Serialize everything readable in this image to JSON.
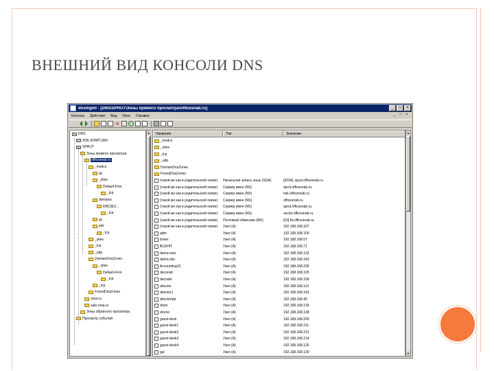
{
  "slide": {
    "title": "ВНЕШНИЙ ВИД КОНСОЛИ DNS",
    "accent_color": "#f57a3d",
    "frame_color": "#f4c9b8"
  },
  "window": {
    "title": "dnsmgmt - [DNS\\SPRUT\\Зоны прямого просмотра\\officesnab.ru]",
    "minimize": "_",
    "maximize": "□",
    "close": "×",
    "menu": [
      "Консоль",
      "Действие",
      "Вид",
      "Окно",
      "Справка"
    ],
    "mdi_buttons": [
      "_",
      "□",
      "×"
    ],
    "titlebar_color": "#0a246a"
  },
  "tree": {
    "items": [
      {
        "label": "DNS"
      },
      {
        "label": "ЛОК.КОМП.SRV"
      },
      {
        "label": "SPRUT"
      },
      {
        "label": "Зоны прямого просмотра"
      },
      {
        "label": "officesnab.ru"
      },
      {
        "label": "_msdcs"
      },
      {
        "label": "dc"
      },
      {
        "label": "_sites"
      },
      {
        "label": "Default-First"
      },
      {
        "label": "_tcp"
      },
      {
        "label": "domains"
      },
      {
        "label": "KBC3E2..."
      },
      {
        "label": "_tcp"
      },
      {
        "label": "gc"
      },
      {
        "label": "pdc"
      },
      {
        "label": "_tcp"
      },
      {
        "label": "_sites"
      },
      {
        "label": "_tcp"
      },
      {
        "label": "_udp"
      },
      {
        "label": "DomainDnsZones"
      },
      {
        "label": "_sites"
      },
      {
        "label": "Default-First"
      },
      {
        "label": "_tcp"
      },
      {
        "label": "_tcp"
      },
      {
        "label": "ForestDnsZones"
      },
      {
        "label": "runa.ru"
      },
      {
        "label": "sale.runa.ru"
      },
      {
        "label": "Зоны обратного просмотра"
      },
      {
        "label": "Просмотр событий"
      }
    ]
  },
  "list": {
    "columns": [
      "Название",
      "Тип",
      "Значение"
    ],
    "rows": [
      {
        "name": "_msdcs",
        "type": "",
        "value": "",
        "folder": true
      },
      {
        "name": "_sites",
        "type": "",
        "value": "",
        "folder": true
      },
      {
        "name": "_tcp",
        "type": "",
        "value": "",
        "folder": true
      },
      {
        "name": "_udp",
        "type": "",
        "value": "",
        "folder": true
      },
      {
        "name": "DomainDnsZones",
        "type": "",
        "value": "",
        "folder": true
      },
      {
        "name": "ForestDnsZones",
        "type": "",
        "value": "",
        "folder": true
      },
      {
        "name": "(такой же как в родительской папке)",
        "type": "Начальная запись зоны (SOA)",
        "value": "[2034], sprut.officesnab.ru",
        "folder": false
      },
      {
        "name": "(такой же как в родительской папке)",
        "type": "Сервер имен (NS)",
        "value": "sprut.officesnab.ru.",
        "folder": false
      },
      {
        "name": "(такой же как в родительской папке)",
        "type": "Сервер имен (NS)",
        "value": "nsk.officesnab.ru.",
        "folder": false
      },
      {
        "name": "(такой же как в родительской папке)",
        "type": "Сервер имен (NS)",
        "value": "officesnab.ru.",
        "folder": false
      },
      {
        "name": "(такой же как в родительской папке)",
        "type": "Сервер имен (NS)",
        "value": "sprut.officesnab.ru.",
        "folder": false
      },
      {
        "name": "(такой же как в родительской папке)",
        "type": "Сервер имен (NS)",
        "value": "vector.officesnab.ru.",
        "folder": false
      },
      {
        "name": "(такой же как в родительской папке)",
        "type": "Почтовый обменник (MX)",
        "value": "[10] fw.officesnab.ru.",
        "folder": false
      },
      {
        "name": "(такой же как в родительской папке)",
        "type": "Узел (A)",
        "value": "192.168.168.107",
        "folder": false
      },
      {
        "name": "adm",
        "type": "Узел (A)",
        "value": "192.168.168.100",
        "folder": false
      },
      {
        "name": "boxer",
        "type": "Узел (A)",
        "value": "192.168.168.67",
        "folder": false
      },
      {
        "name": "BUXHIT",
        "type": "Узел (A)",
        "value": "192.168.168.71",
        "folder": false
      },
      {
        "name": "demo-new",
        "type": "Узел (A)",
        "value": "192.168.168.132",
        "folder": false
      },
      {
        "name": "demo-ofis",
        "type": "Узел (A)",
        "value": "192.168.168.243",
        "folder": false
      },
      {
        "name": "Accounting1C",
        "type": "Узел (A)",
        "value": "192.168.168.236",
        "folder": false
      },
      {
        "name": "deconstr",
        "type": "Узел (A)",
        "value": "192.168.168.105",
        "folder": false
      },
      {
        "name": "decoder",
        "type": "Узел (A)",
        "value": "192.168.168.109",
        "folder": false
      },
      {
        "name": "director",
        "type": "Узел (A)",
        "value": "192.168.168.110",
        "folder": false
      },
      {
        "name": "director1",
        "type": "Узел (A)",
        "value": "192.168.168.143",
        "folder": false
      },
      {
        "name": "directorlab",
        "type": "Узел (A)",
        "value": "192.168.168.40",
        "folder": false
      },
      {
        "name": "drom",
        "type": "Узел (A)",
        "value": "192.168.168.139",
        "folder": false
      },
      {
        "name": "dromo",
        "type": "Узел (A)",
        "value": "192.168.168.138",
        "folder": false
      },
      {
        "name": "guest-desk",
        "type": "Узел (A)",
        "value": "192.168.168.200",
        "folder": false
      },
      {
        "name": "guest-desk1",
        "type": "Узел (A)",
        "value": "192.168.168.211",
        "folder": false
      },
      {
        "name": "guest-desk2",
        "type": "Узел (A)",
        "value": "192.168.168.212",
        "folder": false
      },
      {
        "name": "guest-desk3",
        "type": "Узел (A)",
        "value": "192.168.168.214",
        "folder": false
      },
      {
        "name": "guest-desk4",
        "type": "Узел (A)",
        "value": "192.168.168.125",
        "folder": false
      },
      {
        "name": "gul",
        "type": "Узел (A)",
        "value": "192.168.168.130",
        "folder": false
      }
    ]
  }
}
